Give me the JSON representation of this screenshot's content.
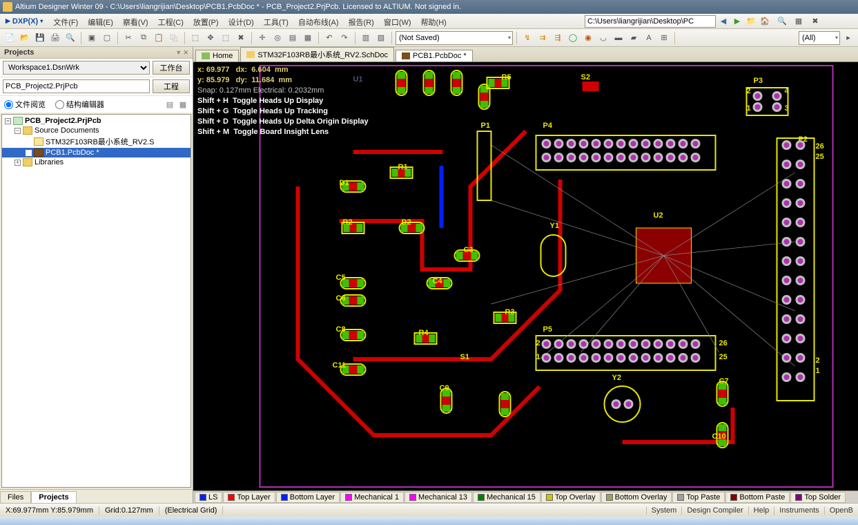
{
  "title": "Altium Designer Winter 09 - C:\\Users\\liangrijian\\Desktop\\PCB1.PcbDoc * - PCB_Project2.PrjPcb. Licensed to ALTIUM. Not signed in.",
  "menu": {
    "dxp": "DXP(X)",
    "items": [
      "文件(F)",
      "编辑(E)",
      "察看(V)",
      "工程(C)",
      "放置(P)",
      "设计(D)",
      "工具(T)",
      "自动布线(A)",
      "报告(R)",
      "窗口(W)",
      "帮助(H)"
    ]
  },
  "path": "C:\\Users\\liangrijian\\Desktop\\PC",
  "toolbar": {
    "saved_state": "(Not Saved)",
    "filter": "(All)"
  },
  "projects": {
    "panel_title": "Projects",
    "workspace": "Workspace1.DsnWrk",
    "workspace_btn": "工作台",
    "project": "PCB_Project2.PrjPcb",
    "project_btn": "工程",
    "view_mode_a": "文件阅览",
    "view_mode_b": "结构编辑器",
    "tree": {
      "root": "PCB_Project2.PrjPcb",
      "src": "Source Documents",
      "sch": "STM32F103RB最小系统_RV2.S",
      "pcb": "PCB1.PcbDoc *",
      "lib": "Libraries"
    },
    "tabs": [
      "Files",
      "Projects"
    ]
  },
  "doc_tabs": {
    "home": "Home",
    "sch": "STM32F103RB最小系统_RV2.SchDoc",
    "pcb": "PCB1.PcbDoc *"
  },
  "hud": {
    "x_label": "x:",
    "x": "69.977",
    "dx_label": "dx:",
    "dx": "6.604",
    "unit1": "mm",
    "y_label": "y:",
    "y": "85.979",
    "dy_label": "dy:",
    "dy": "11.684",
    "unit2": "mm",
    "snap": "Snap: 0.127mm Electrical: 0.2032mm",
    "h1a": "Shift + H",
    "h1b": "Toggle Heads Up Display",
    "h2a": "Shift + G",
    "h2b": "Toggle Heads Up Tracking",
    "h3a": "Shift + D",
    "h3b": "Toggle Heads Up Delta Origin Display",
    "h4a": "Shift + M",
    "h4b": "Toggle Board Insight Lens"
  },
  "designators": {
    "U1": "U1",
    "R5": "R5",
    "S2": "S2",
    "P3": "P3",
    "P4": "P4",
    "P1": "P1",
    "P2": "P2",
    "D1": "D1",
    "R1": "R1",
    "R2": "R2",
    "D2": "D2",
    "C3": "C3",
    "Y1": "Y1",
    "U2": "U2",
    "C5": "C5",
    "C6": "C6",
    "C4": "C4",
    "R3": "R3",
    "C8": "C8",
    "R4": "R4",
    "P5": "P5",
    "C11": "C11",
    "S1": "S1",
    "Y2": "Y2",
    "C7": "C7",
    "C9": "C9",
    "C10": "C10",
    "n1": "1",
    "n2": "2",
    "n3": "3",
    "n4": "4",
    "n25a": "25",
    "n26a": "26",
    "n1b": "1",
    "n2b": "2",
    "n25b": "25",
    "n26b": "26",
    "n1c": "1",
    "n2c": "2"
  },
  "layers": {
    "ls": "LS",
    "top": "Top Layer",
    "bot": "Bottom Layer",
    "m1": "Mechanical 1",
    "m13": "Mechanical 13",
    "m15": "Mechanical 15",
    "ovT": "Top Overlay",
    "ovB": "Bottom Overlay",
    "pT": "Top Paste",
    "pB": "Bottom Paste",
    "sT": "Top Solder"
  },
  "status": {
    "coord": "X:69.977mm Y:85.979mm",
    "grid": "Grid:0.127mm",
    "egrid": "(Electrical Grid)",
    "links": [
      "System",
      "Design Compiler",
      "Help",
      "Instruments",
      "OpenB"
    ]
  }
}
